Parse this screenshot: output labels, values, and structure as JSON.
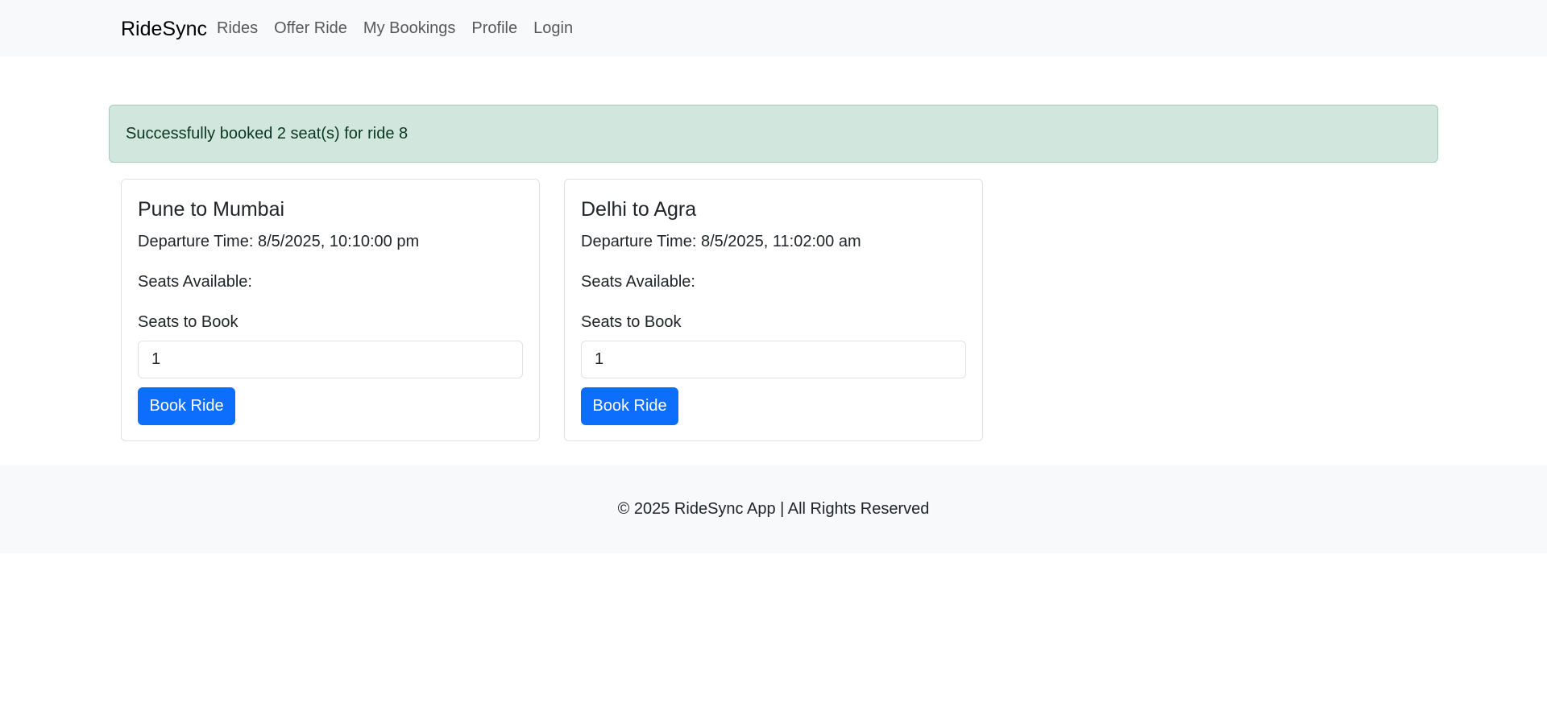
{
  "navbar": {
    "brand": "RideSync",
    "links": [
      "Rides",
      "Offer Ride",
      "My Bookings",
      "Profile",
      "Login"
    ]
  },
  "alert": {
    "message": "Successfully booked 2 seat(s) for ride 8",
    "type": "success"
  },
  "rides": [
    {
      "title": "Pune to Mumbai",
      "departure": "Departure Time: 8/5/2025, 10:10:00 pm",
      "seats_available": "Seats Available:",
      "seats_label": "Seats to Book",
      "seats_value": "1",
      "button_label": "Book Ride"
    },
    {
      "title": "Delhi to Agra",
      "departure": "Departure Time: 8/5/2025, 11:02:00 am",
      "seats_available": "Seats Available:",
      "seats_label": "Seats to Book",
      "seats_value": "1",
      "button_label": "Book Ride"
    }
  ],
  "footer": {
    "text": "© 2025 RideSync App | All Rights Reserved"
  },
  "colors": {
    "navbar_bg": "#f8f9fa",
    "alert_bg": "#d1e7dd",
    "alert_border": "#a3cfbb",
    "alert_text": "#0a3622",
    "primary": "#0d6efd",
    "footer_bg": "#f8f9fa"
  }
}
